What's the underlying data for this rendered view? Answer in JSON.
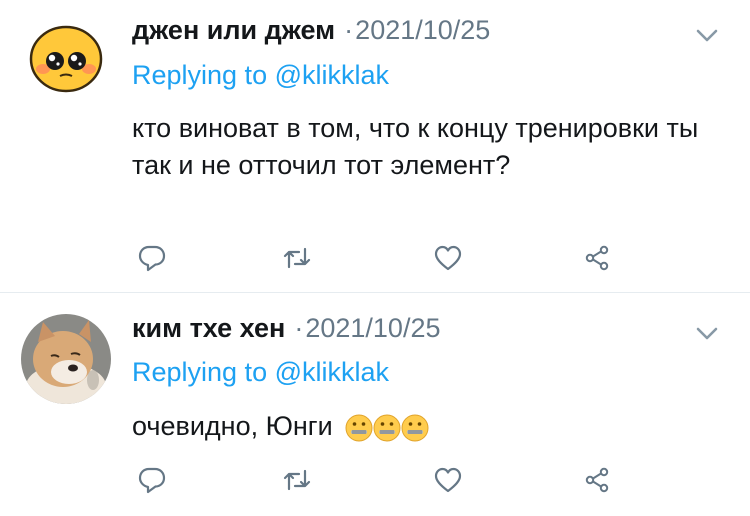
{
  "tweets": [
    {
      "name": "джен или джем",
      "separator": "·",
      "date": "2021/10/25",
      "replying_prefix": "Replying to",
      "replying_handle": "@klikklak",
      "text": "кто виноват в том, что к концу тренировки ты так и не отточил тот элемент?",
      "emoji": []
    },
    {
      "name": "ким тхе хен",
      "separator": "·",
      "date": "2021/10/25",
      "replying_prefix": "Replying to",
      "replying_handle": "@klikklak",
      "text": "очевидно, Юнги",
      "emoji": [
        "zipper-mouth-face",
        "zipper-mouth-face",
        "zipper-mouth-face"
      ]
    }
  ],
  "icons": {
    "reply": "reply-icon",
    "retweet": "retweet-icon",
    "like": "heart-icon",
    "share": "share-icon",
    "more": "chevron-down-icon"
  },
  "colors": {
    "link": "#1da1f2",
    "secondary": "#657786",
    "text": "#14171a",
    "divider": "#e6ecf0"
  }
}
